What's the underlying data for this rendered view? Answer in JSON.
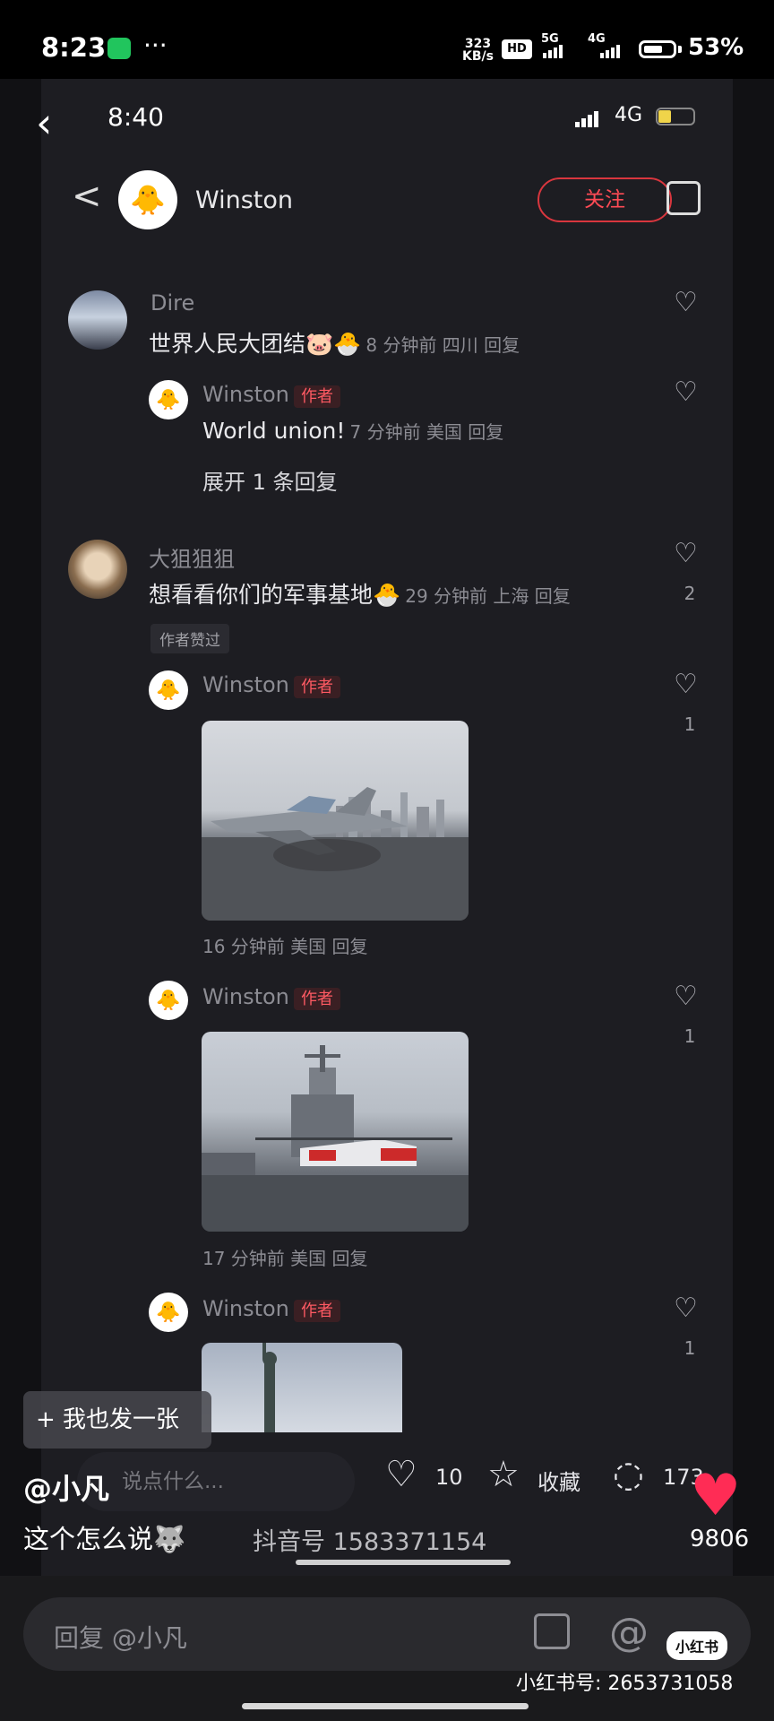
{
  "outer_status": {
    "time": "8:23",
    "more": "···",
    "net_speed_top": "323",
    "net_speed_unit": "KB/s",
    "hd": "HD",
    "signal1": "5G",
    "signal2": "4G",
    "battery": "53%"
  },
  "inner_status": {
    "time": "8:40",
    "network": "4G"
  },
  "header": {
    "back": "<",
    "name": "Winston",
    "follow": "关注"
  },
  "comments": [
    {
      "user": "Dire",
      "text": "世界人民大团结🐷🐣",
      "meta": "8 分钟前 四川 回复",
      "reply": {
        "user": "Winston",
        "tag": "作者",
        "text": "World union!",
        "meta": "7 分钟前 美国 回复"
      },
      "expand": "展开 1 条回复"
    },
    {
      "user": "大狙狙狙",
      "text": "想看看你们的军事基地🐣",
      "meta": "29 分钟前 上海 回复",
      "likes": "2",
      "chip": "作者赞过",
      "replies": [
        {
          "user": "Winston",
          "tag": "作者",
          "likes": "1",
          "meta": "16 分钟前 美国 回复"
        },
        {
          "user": "Winston",
          "tag": "作者",
          "likes": "1",
          "meta": "17 分钟前 美国 回复"
        },
        {
          "user": "Winston",
          "tag": "作者",
          "likes": "1"
        }
      ]
    }
  ],
  "overlay": {
    "share_pill": "+ 我也发一张",
    "username": "@小凡",
    "caption": "这个怎么说🐺",
    "input_placeholder": "说点什么...",
    "likes": "10",
    "collect": "收藏",
    "comments": "173",
    "total_likes": "9806",
    "watermark": "抖音号 1583371154"
  },
  "bottom": {
    "reply_placeholder": "回复 @小凡",
    "badge": "小红书",
    "xhs_id": "小红书号: 2653731058"
  }
}
